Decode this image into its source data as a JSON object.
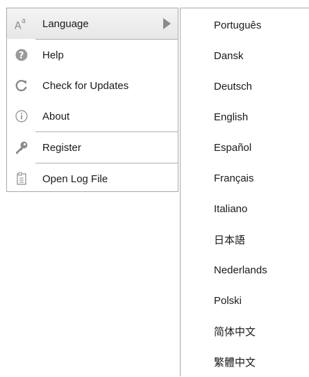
{
  "main_menu": {
    "items": [
      {
        "label": "Language",
        "icon": "language-icon"
      },
      {
        "label": "Help",
        "icon": "help-icon"
      },
      {
        "label": "Check for Updates",
        "icon": "refresh-icon"
      },
      {
        "label": "About",
        "icon": "info-icon"
      },
      {
        "label": "Register",
        "icon": "key-icon"
      },
      {
        "label": "Open Log File",
        "icon": "log-file-icon"
      }
    ],
    "icon_glyphs": {
      "language_a": "A",
      "language_b": "a"
    }
  },
  "language_menu": {
    "items": [
      "Português",
      "Dansk",
      "Deutsch",
      "English",
      "Español",
      "Français",
      "Italiano",
      "日本語",
      "Nederlands",
      "Polski",
      "简体中文",
      "繁體中文"
    ]
  },
  "colors": {
    "border": "#a8a8a8",
    "highlight": "#ececec",
    "text": "#1a1a1a",
    "icon": "#888888"
  }
}
